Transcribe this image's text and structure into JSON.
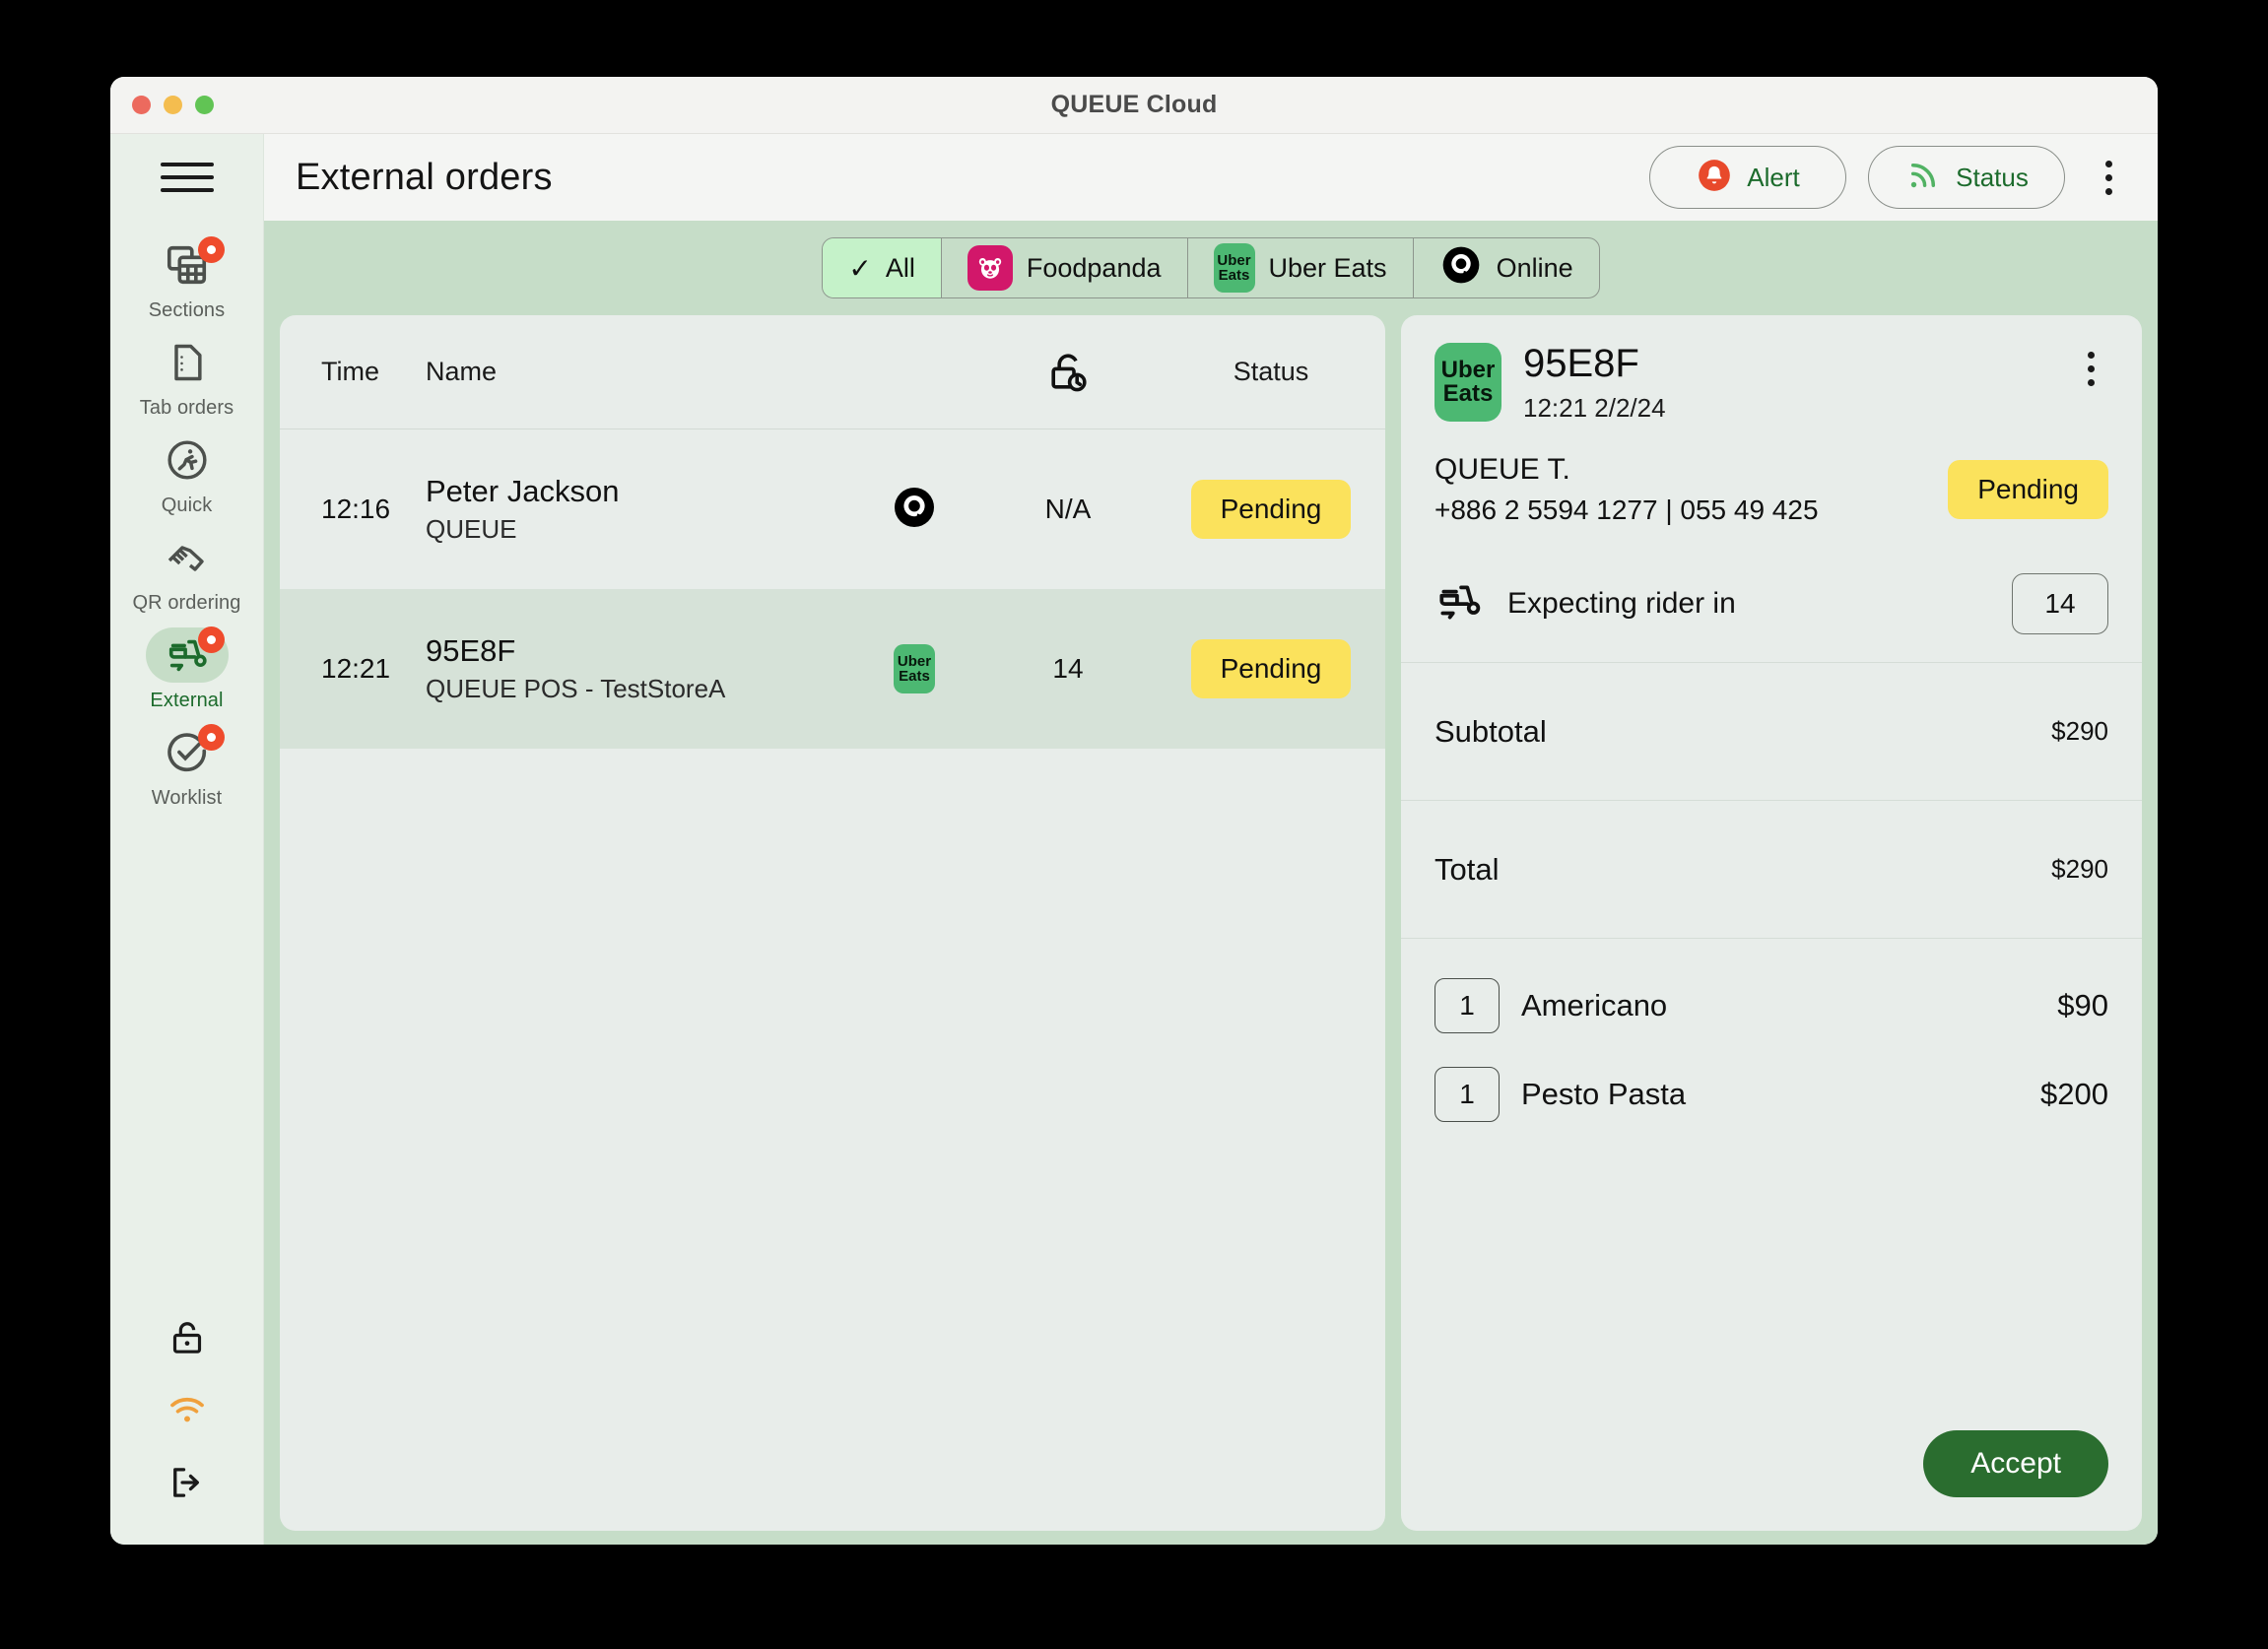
{
  "window": {
    "title": "QUEUE Cloud",
    "traffic_lights": [
      "close",
      "minimize",
      "zoom"
    ]
  },
  "sidebar": {
    "menu_icon": "hamburger-icon",
    "items": [
      {
        "label": "Sections",
        "icon": "sections-icon",
        "badge": true,
        "active": false
      },
      {
        "label": "Tab orders",
        "icon": "document-icon",
        "badge": false,
        "active": false
      },
      {
        "label": "Quick",
        "icon": "runner-icon",
        "badge": false,
        "active": false
      },
      {
        "label": "QR ordering",
        "icon": "handshake-icon",
        "badge": false,
        "active": false
      },
      {
        "label": "External",
        "icon": "scooter-icon",
        "badge": true,
        "active": true
      },
      {
        "label": "Worklist",
        "icon": "check-circle-icon",
        "badge": true,
        "active": false
      }
    ],
    "bottom_icons": [
      {
        "name": "unlock-icon",
        "color": "#1a1a1a"
      },
      {
        "name": "wifi-icon",
        "color": "#f0a03c"
      },
      {
        "name": "logout-icon",
        "color": "#1a1a1a"
      }
    ]
  },
  "header": {
    "title": "External orders",
    "alert_button": {
      "label": "Alert",
      "icon": "bell-icon",
      "icon_color": "#e8492b"
    },
    "status_button": {
      "label": "Status",
      "icon": "signal-icon",
      "icon_color": "#51b263"
    },
    "kebab": "more-vertical-icon"
  },
  "filters": {
    "tabs": [
      {
        "label": "All",
        "icon": "check-icon",
        "active": true
      },
      {
        "label": "Foodpanda",
        "icon": "foodpanda-icon",
        "active": false
      },
      {
        "label": "Uber Eats",
        "icon": "ubereats-icon",
        "active": false
      },
      {
        "label": "Online",
        "icon": "online-icon",
        "active": false
      }
    ]
  },
  "orders_table": {
    "columns": [
      "Time",
      "Name",
      "",
      "",
      "Status"
    ],
    "lock_icon": "lock-clock-icon",
    "rows": [
      {
        "time": "12:16",
        "name": "Peter Jackson",
        "subname": "QUEUE",
        "platform": "online-icon",
        "eta": "N/A",
        "status": "Pending",
        "selected": false
      },
      {
        "time": "12:21",
        "name": "95E8F",
        "subname": "QUEUE POS - TestStoreA",
        "platform": "ubereats-icon",
        "eta": "14",
        "status": "Pending",
        "selected": true
      }
    ]
  },
  "detail": {
    "platform_badge": {
      "line1": "Uber",
      "line2": "Eats",
      "color": "#4cb872"
    },
    "order_id": "95E8F",
    "order_time": "12:21 2/2/24",
    "kebab": "more-vertical-icon",
    "customer_name": "QUEUE T.",
    "customer_phone": "+886 2 5594 1277 | 055 49 425",
    "status": "Pending",
    "rider": {
      "icon": "scooter-icon",
      "label": "Expecting rider in",
      "minutes": "14"
    },
    "totals": [
      {
        "label": "Subtotal",
        "value": "$290"
      },
      {
        "label": "Total",
        "value": "$290"
      }
    ],
    "items": [
      {
        "qty": "1",
        "name": "Americano",
        "price": "$90"
      },
      {
        "qty": "1",
        "name": "Pesto Pasta",
        "price": "$200"
      }
    ],
    "accept_button": "Accept"
  },
  "colors": {
    "accent_green": "#2a6d2f",
    "toolbar_green": "#c6ddc8",
    "card_bg": "#e8edea",
    "selected_row": "#d6e2d8",
    "pending_yellow": "#fbe25c",
    "badge_red": "#ef4b2c",
    "ubereats_green": "#4cb872",
    "foodpanda_pink": "#d2176a",
    "wifi_orange": "#f0a03c"
  }
}
